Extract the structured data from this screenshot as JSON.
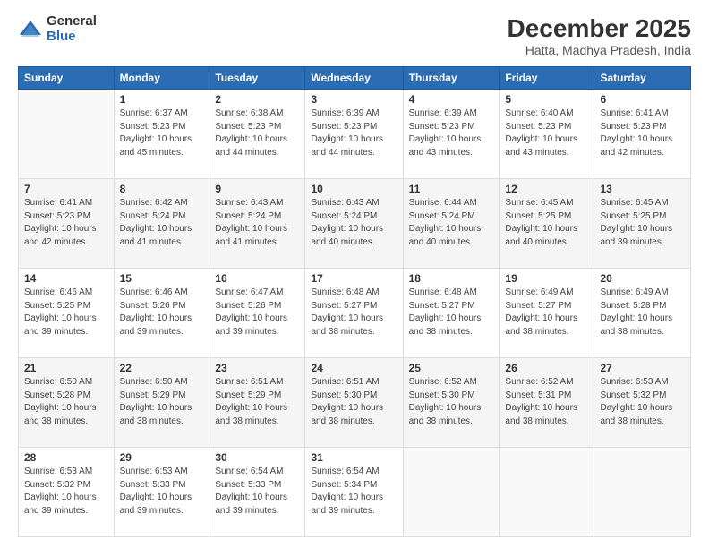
{
  "header": {
    "logo": {
      "general": "General",
      "blue": "Blue"
    },
    "title": "December 2025",
    "subtitle": "Hatta, Madhya Pradesh, India"
  },
  "calendar": {
    "headers": [
      "Sunday",
      "Monday",
      "Tuesday",
      "Wednesday",
      "Thursday",
      "Friday",
      "Saturday"
    ],
    "rows": [
      [
        {
          "day": "",
          "info": ""
        },
        {
          "day": "1",
          "info": "Sunrise: 6:37 AM\nSunset: 5:23 PM\nDaylight: 10 hours\nand 45 minutes."
        },
        {
          "day": "2",
          "info": "Sunrise: 6:38 AM\nSunset: 5:23 PM\nDaylight: 10 hours\nand 44 minutes."
        },
        {
          "day": "3",
          "info": "Sunrise: 6:39 AM\nSunset: 5:23 PM\nDaylight: 10 hours\nand 44 minutes."
        },
        {
          "day": "4",
          "info": "Sunrise: 6:39 AM\nSunset: 5:23 PM\nDaylight: 10 hours\nand 43 minutes."
        },
        {
          "day": "5",
          "info": "Sunrise: 6:40 AM\nSunset: 5:23 PM\nDaylight: 10 hours\nand 43 minutes."
        },
        {
          "day": "6",
          "info": "Sunrise: 6:41 AM\nSunset: 5:23 PM\nDaylight: 10 hours\nand 42 minutes."
        }
      ],
      [
        {
          "day": "7",
          "info": "Sunrise: 6:41 AM\nSunset: 5:23 PM\nDaylight: 10 hours\nand 42 minutes."
        },
        {
          "day": "8",
          "info": "Sunrise: 6:42 AM\nSunset: 5:24 PM\nDaylight: 10 hours\nand 41 minutes."
        },
        {
          "day": "9",
          "info": "Sunrise: 6:43 AM\nSunset: 5:24 PM\nDaylight: 10 hours\nand 41 minutes."
        },
        {
          "day": "10",
          "info": "Sunrise: 6:43 AM\nSunset: 5:24 PM\nDaylight: 10 hours\nand 40 minutes."
        },
        {
          "day": "11",
          "info": "Sunrise: 6:44 AM\nSunset: 5:24 PM\nDaylight: 10 hours\nand 40 minutes."
        },
        {
          "day": "12",
          "info": "Sunrise: 6:45 AM\nSunset: 5:25 PM\nDaylight: 10 hours\nand 40 minutes."
        },
        {
          "day": "13",
          "info": "Sunrise: 6:45 AM\nSunset: 5:25 PM\nDaylight: 10 hours\nand 39 minutes."
        }
      ],
      [
        {
          "day": "14",
          "info": "Sunrise: 6:46 AM\nSunset: 5:25 PM\nDaylight: 10 hours\nand 39 minutes."
        },
        {
          "day": "15",
          "info": "Sunrise: 6:46 AM\nSunset: 5:26 PM\nDaylight: 10 hours\nand 39 minutes."
        },
        {
          "day": "16",
          "info": "Sunrise: 6:47 AM\nSunset: 5:26 PM\nDaylight: 10 hours\nand 39 minutes."
        },
        {
          "day": "17",
          "info": "Sunrise: 6:48 AM\nSunset: 5:27 PM\nDaylight: 10 hours\nand 38 minutes."
        },
        {
          "day": "18",
          "info": "Sunrise: 6:48 AM\nSunset: 5:27 PM\nDaylight: 10 hours\nand 38 minutes."
        },
        {
          "day": "19",
          "info": "Sunrise: 6:49 AM\nSunset: 5:27 PM\nDaylight: 10 hours\nand 38 minutes."
        },
        {
          "day": "20",
          "info": "Sunrise: 6:49 AM\nSunset: 5:28 PM\nDaylight: 10 hours\nand 38 minutes."
        }
      ],
      [
        {
          "day": "21",
          "info": "Sunrise: 6:50 AM\nSunset: 5:28 PM\nDaylight: 10 hours\nand 38 minutes."
        },
        {
          "day": "22",
          "info": "Sunrise: 6:50 AM\nSunset: 5:29 PM\nDaylight: 10 hours\nand 38 minutes."
        },
        {
          "day": "23",
          "info": "Sunrise: 6:51 AM\nSunset: 5:29 PM\nDaylight: 10 hours\nand 38 minutes."
        },
        {
          "day": "24",
          "info": "Sunrise: 6:51 AM\nSunset: 5:30 PM\nDaylight: 10 hours\nand 38 minutes."
        },
        {
          "day": "25",
          "info": "Sunrise: 6:52 AM\nSunset: 5:30 PM\nDaylight: 10 hours\nand 38 minutes."
        },
        {
          "day": "26",
          "info": "Sunrise: 6:52 AM\nSunset: 5:31 PM\nDaylight: 10 hours\nand 38 minutes."
        },
        {
          "day": "27",
          "info": "Sunrise: 6:53 AM\nSunset: 5:32 PM\nDaylight: 10 hours\nand 38 minutes."
        }
      ],
      [
        {
          "day": "28",
          "info": "Sunrise: 6:53 AM\nSunset: 5:32 PM\nDaylight: 10 hours\nand 39 minutes."
        },
        {
          "day": "29",
          "info": "Sunrise: 6:53 AM\nSunset: 5:33 PM\nDaylight: 10 hours\nand 39 minutes."
        },
        {
          "day": "30",
          "info": "Sunrise: 6:54 AM\nSunset: 5:33 PM\nDaylight: 10 hours\nand 39 minutes."
        },
        {
          "day": "31",
          "info": "Sunrise: 6:54 AM\nSunset: 5:34 PM\nDaylight: 10 hours\nand 39 minutes."
        },
        {
          "day": "",
          "info": ""
        },
        {
          "day": "",
          "info": ""
        },
        {
          "day": "",
          "info": ""
        }
      ]
    ]
  }
}
